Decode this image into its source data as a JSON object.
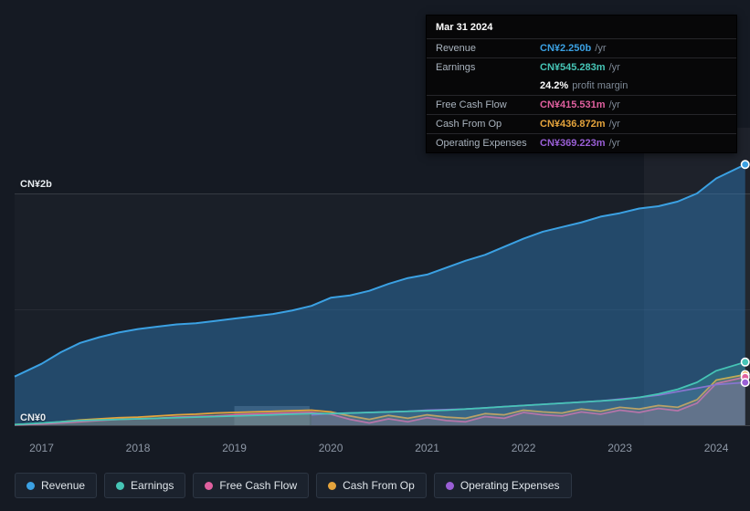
{
  "tooltip": {
    "date": "Mar 31 2024",
    "rows": [
      {
        "label": "Revenue",
        "value": "CN¥2.250b",
        "suffix": "/yr",
        "color": "#3ba1e3",
        "sep": true
      },
      {
        "label": "Earnings",
        "value": "CN¥545.283m",
        "suffix": "/yr",
        "color": "#46c5b6",
        "sep": true
      },
      {
        "label": "",
        "value": "24.2%",
        "suffix": "profit margin",
        "color": "#ffffff",
        "sep": false
      },
      {
        "label": "Free Cash Flow",
        "value": "CN¥415.531m",
        "suffix": "/yr",
        "color": "#e0609f",
        "sep": true
      },
      {
        "label": "Cash From Op",
        "value": "CN¥436.872m",
        "suffix": "/yr",
        "color": "#e5a43c",
        "sep": true
      },
      {
        "label": "Operating Expenses",
        "value": "CN¥369.223m",
        "suffix": "/yr",
        "color": "#9a5fd6",
        "sep": true
      }
    ]
  },
  "legend": [
    {
      "label": "Revenue",
      "color": "#3ba1e3"
    },
    {
      "label": "Earnings",
      "color": "#46c5b6"
    },
    {
      "label": "Free Cash Flow",
      "color": "#e0609f"
    },
    {
      "label": "Cash From Op",
      "color": "#e5a43c"
    },
    {
      "label": "Operating Expenses",
      "color": "#9a5fd6"
    }
  ],
  "chart_data": {
    "type": "area",
    "units": "CN¥ billions per year",
    "ylim": [
      0,
      2.5
    ],
    "y_axis_labels": {
      "top": "CN¥2b",
      "bottom": "CN¥0"
    },
    "x_ticks": [
      2017,
      2018,
      2019,
      2020,
      2021,
      2022,
      2023,
      2024
    ],
    "xlim": [
      2016.72,
      2024.35
    ],
    "forecast_band_start": 2023.25,
    "grey_band": [
      2019.0,
      2019.78
    ],
    "grid": true,
    "legend_position": "bottom",
    "series": [
      {
        "name": "Revenue",
        "color": "#3ba1e3",
        "fill": "rgba(47,124,188,0.45)",
        "width": 2,
        "x": [
          2016.72,
          2017,
          2017.2,
          2017.4,
          2017.6,
          2017.8,
          2018,
          2018.2,
          2018.4,
          2018.6,
          2018.8,
          2019,
          2019.2,
          2019.4,
          2019.6,
          2019.8,
          2020,
          2020.2,
          2020.4,
          2020.6,
          2020.8,
          2021,
          2021.2,
          2021.4,
          2021.6,
          2021.8,
          2022,
          2022.2,
          2022.4,
          2022.6,
          2022.8,
          2023,
          2023.2,
          2023.4,
          2023.6,
          2023.8,
          2024,
          2024.3
        ],
        "values": [
          0.42,
          0.53,
          0.63,
          0.71,
          0.76,
          0.8,
          0.83,
          0.85,
          0.87,
          0.88,
          0.9,
          0.92,
          0.94,
          0.96,
          0.99,
          1.03,
          1.1,
          1.12,
          1.16,
          1.22,
          1.27,
          1.3,
          1.36,
          1.42,
          1.47,
          1.54,
          1.61,
          1.67,
          1.71,
          1.75,
          1.8,
          1.83,
          1.87,
          1.89,
          1.93,
          2.0,
          2.13,
          2.25
        ]
      },
      {
        "name": "Cash From Op",
        "color": "#e5a43c",
        "fill": "rgba(229,164,60,0.18)",
        "width": 1.75,
        "x": [
          2016.72,
          2017,
          2017.2,
          2017.4,
          2017.6,
          2017.8,
          2018,
          2018.2,
          2018.4,
          2018.6,
          2018.8,
          2019,
          2019.2,
          2019.4,
          2019.6,
          2019.8,
          2020,
          2020.2,
          2020.4,
          2020.6,
          2020.8,
          2021,
          2021.2,
          2021.4,
          2021.6,
          2021.8,
          2022,
          2022.2,
          2022.4,
          2022.6,
          2022.8,
          2023,
          2023.2,
          2023.4,
          2023.6,
          2023.8,
          2024,
          2024.3
        ],
        "values": [
          0.006,
          0.015,
          0.03,
          0.045,
          0.055,
          0.065,
          0.07,
          0.08,
          0.09,
          0.095,
          0.105,
          0.11,
          0.115,
          0.12,
          0.125,
          0.13,
          0.115,
          0.08,
          0.05,
          0.085,
          0.06,
          0.09,
          0.07,
          0.06,
          0.1,
          0.09,
          0.13,
          0.115,
          0.105,
          0.14,
          0.12,
          0.155,
          0.14,
          0.17,
          0.155,
          0.22,
          0.39,
          0.4369
        ]
      },
      {
        "name": "Free Cash Flow",
        "color": "#e0609f",
        "fill": "rgba(224,96,159,0.18)",
        "width": 1.75,
        "x": [
          2016.72,
          2017,
          2017.2,
          2017.4,
          2017.6,
          2017.8,
          2018,
          2018.2,
          2018.4,
          2018.6,
          2018.8,
          2019,
          2019.2,
          2019.4,
          2019.6,
          2019.8,
          2020,
          2020.2,
          2020.4,
          2020.6,
          2020.8,
          2021,
          2021.2,
          2021.4,
          2021.6,
          2021.8,
          2022,
          2022.2,
          2022.4,
          2022.6,
          2022.8,
          2023,
          2023.2,
          2023.4,
          2023.6,
          2023.8,
          2024,
          2024.3
        ],
        "values": [
          0.003,
          0.01,
          0.02,
          0.03,
          0.04,
          0.05,
          0.055,
          0.06,
          0.07,
          0.075,
          0.08,
          0.09,
          0.095,
          0.1,
          0.105,
          0.11,
          0.095,
          0.05,
          0.02,
          0.055,
          0.03,
          0.065,
          0.04,
          0.03,
          0.075,
          0.06,
          0.11,
          0.09,
          0.08,
          0.115,
          0.095,
          0.13,
          0.11,
          0.145,
          0.125,
          0.19,
          0.36,
          0.4155
        ]
      },
      {
        "name": "Operating Expenses",
        "color": "#9a5fd6",
        "fill": "rgba(154,95,214,0.15)",
        "width": 1.75,
        "x": [
          2019.8,
          2020,
          2020.2,
          2020.4,
          2020.6,
          2020.8,
          2021,
          2021.2,
          2021.4,
          2021.6,
          2021.8,
          2022,
          2022.2,
          2022.4,
          2022.6,
          2022.8,
          2023,
          2023.2,
          2023.4,
          2023.6,
          2023.8,
          2024,
          2024.3
        ],
        "values": [
          0.09,
          0.1,
          0.105,
          0.11,
          0.115,
          0.12,
          0.13,
          0.135,
          0.14,
          0.15,
          0.16,
          0.17,
          0.18,
          0.19,
          0.2,
          0.21,
          0.225,
          0.24,
          0.26,
          0.29,
          0.32,
          0.35,
          0.369
        ]
      },
      {
        "name": "Earnings",
        "color": "#46c5b6",
        "fill": "rgba(70,197,182,0.22)",
        "width": 1.75,
        "x": [
          2016.72,
          2017,
          2017.2,
          2017.4,
          2017.6,
          2017.8,
          2018,
          2018.2,
          2018.4,
          2018.6,
          2018.8,
          2019,
          2019.2,
          2019.4,
          2019.6,
          2019.8,
          2020,
          2020.2,
          2020.4,
          2020.6,
          2020.8,
          2021,
          2021.2,
          2021.4,
          2021.6,
          2021.8,
          2022,
          2022.2,
          2022.4,
          2022.6,
          2022.8,
          2023,
          2023.2,
          2023.4,
          2023.6,
          2023.8,
          2024,
          2024.3
        ],
        "values": [
          0.005,
          0.02,
          0.03,
          0.04,
          0.045,
          0.05,
          0.055,
          0.06,
          0.065,
          0.07,
          0.075,
          0.08,
          0.085,
          0.09,
          0.095,
          0.1,
          0.1,
          0.105,
          0.11,
          0.115,
          0.12,
          0.125,
          0.13,
          0.14,
          0.15,
          0.16,
          0.17,
          0.18,
          0.19,
          0.2,
          0.21,
          0.22,
          0.24,
          0.27,
          0.31,
          0.37,
          0.47,
          0.545
        ]
      }
    ]
  }
}
